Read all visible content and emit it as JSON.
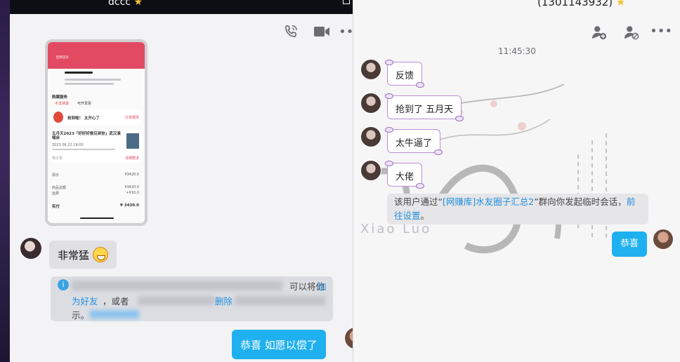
{
  "left_window": {
    "title": "dccc",
    "toolbar": {
      "voice_call": "phone-icon",
      "video_call": "video-icon",
      "more": "more-icon"
    },
    "screenshot": {
      "btn": "回到首页",
      "section_title": "购票服务",
      "opt1": "不支持退",
      "opt2": "可开发票",
      "promo": "抢到啦！ 太开心了",
      "promo_tag": "分享晒单",
      "event_title": "五月天2023「好好好想见到你」武汉演唱会",
      "event_meta": "2023.06.22 19:00",
      "tag": "电子票",
      "row1_label": "票价",
      "row1_value": "¥3420.0",
      "row2_label": "商品总额",
      "row2_value": "¥3420.0",
      "row3_label": "运费",
      "row3_value": "+¥10.0",
      "row4_label": "实付",
      "row4_value": "¥ 3430.0",
      "link": "详细要求"
    },
    "incoming_bubble": "非常猛",
    "system_notice": {
      "line1_tail": "可以将他",
      "link1a": "加",
      "link1b": "为好友",
      "line2_head": "，或者",
      "link2": "删除",
      "line3_head": "示。"
    },
    "outgoing_bubble": "恭喜 如愿以偿了"
  },
  "right_window": {
    "title": "(1301143932)",
    "toolbar": {
      "add_user": "user-add-icon",
      "block_user": "user-block-icon",
      "more": "more-icon"
    },
    "timestamp": "11:45:30",
    "messages": [
      "反馈",
      "抢到了 五月天",
      "太牛逼了",
      "大佬"
    ],
    "system_notice": {
      "prefix": "该用户通过“",
      "group_link": "[网赚库]水友圈子汇总2",
      "middle": "”群向你发起临时会话，",
      "link": "前往设置",
      "suffix": "。"
    },
    "outgoing_bubble": "恭喜",
    "art_caption": "Xiao Luo"
  },
  "colors": {
    "accent_blue": "#1fb0ef",
    "link_blue": "#1f8fe0",
    "bubble_gray": "#e0e0e4"
  }
}
